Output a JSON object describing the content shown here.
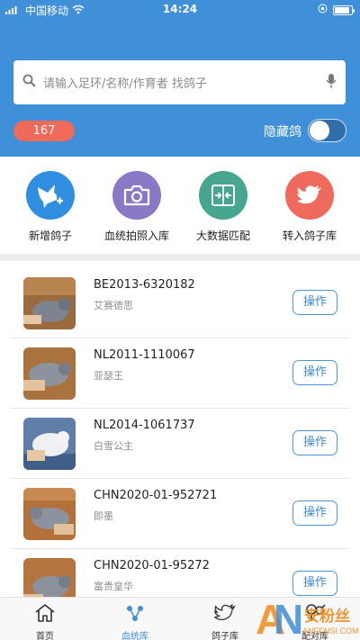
{
  "status_bar": {
    "carrier": "中国移动",
    "time": "14:24"
  },
  "search": {
    "placeholder": "请输入足环/名称/作育者 找鸽子"
  },
  "count_badge": "167",
  "hide_toggle_label": "隐藏鸽",
  "quick_actions": [
    {
      "label": "新增鸽子",
      "icon": "add-pigeon-icon",
      "color": "#2f8ee0"
    },
    {
      "label": "血统拍照入库",
      "icon": "camera-icon",
      "color": "#8a78c6"
    },
    {
      "label": "大数据匹配",
      "icon": "match-icon",
      "color": "#47a690"
    },
    {
      "label": "转入鸽子库",
      "icon": "bird-icon",
      "color": "#ef6a5c"
    }
  ],
  "pigeons": [
    {
      "ring": "BE2013-6320182",
      "name": "艾赛德思",
      "action": "操作"
    },
    {
      "ring": "NL2011-1110067",
      "name": "亚瑟王",
      "action": "操作"
    },
    {
      "ring": "NL2014-1061737",
      "name": "白雪公主",
      "action": "操作"
    },
    {
      "ring": "CHN2020-01-952721",
      "name": "即墨",
      "action": "操作"
    },
    {
      "ring": "CHN2020-01-95272",
      "name": "富贵皇华",
      "action": "操作"
    }
  ],
  "tabs": [
    {
      "label": "首页",
      "icon": "home-icon"
    },
    {
      "label": "血统库",
      "icon": "pedigree-icon"
    },
    {
      "label": "鸽子库",
      "icon": "bird-icon"
    },
    {
      "label": "配对库",
      "icon": "pair-icon"
    }
  ],
  "active_tab": "血统库",
  "watermark": {
    "brand": "安粉丝",
    "url": "ANFENSI.COM",
    "logo_letters": "AN"
  },
  "colors": {
    "header": "#3f8fd9",
    "badge": "#f06a5a",
    "accent": "#3d8bd6"
  }
}
